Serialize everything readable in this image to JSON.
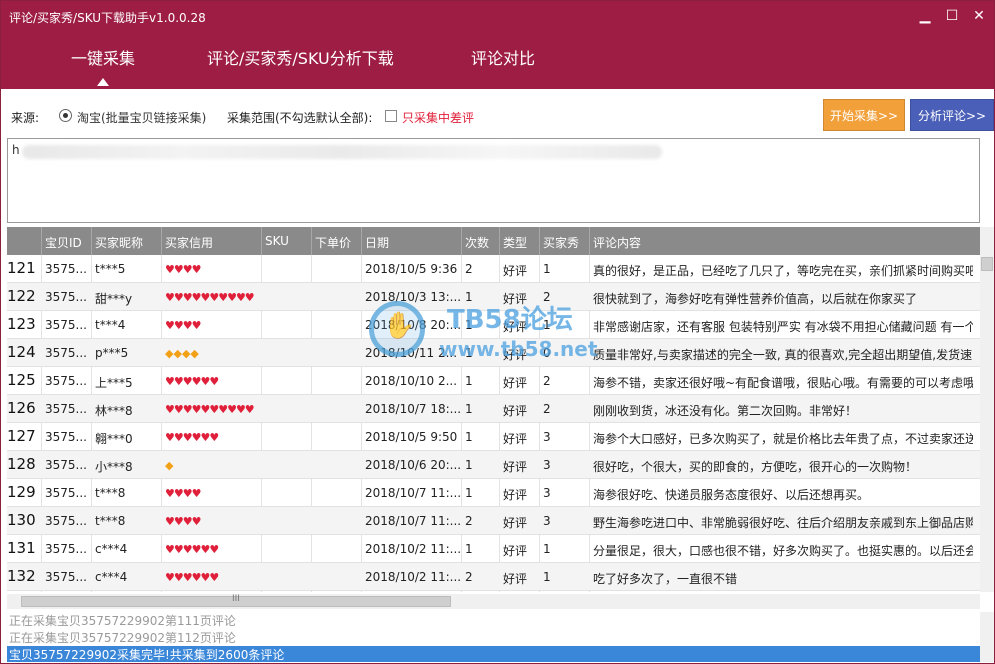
{
  "window": {
    "title": "评论/买家秀/SKU下载助手v1.0.0.28",
    "controls": {
      "minimize": "▁",
      "maximize": "☐",
      "close": "✕"
    }
  },
  "nav": {
    "tabs": [
      {
        "label": "一键采集",
        "active": true
      },
      {
        "label": "评论/买家秀/SKU分析下载",
        "active": false
      },
      {
        "label": "评论对比",
        "active": false
      }
    ]
  },
  "toolbar": {
    "source_label": "来源:",
    "source_option": "淘宝(批量宝贝链接采集)",
    "scope_label": "采集范围(不勾选默认全部):",
    "bad_only_label": "只采集中差评",
    "start_button": "开始采集>>",
    "analyze_button": "分析评论>>"
  },
  "url_input": {
    "value_prefix": "h"
  },
  "table": {
    "columns": [
      "宝贝ID",
      "买家昵称",
      "买家信用",
      "SKU",
      "下单价",
      "日期",
      "次数",
      "类型",
      "买家秀",
      "评论内容"
    ],
    "rows": [
      {
        "n": "121",
        "id": "3575...",
        "nick": "t***5",
        "credit": "hearts:2",
        "sku": "",
        "price": "",
        "date": "2018/10/5 9:36",
        "count": "2",
        "type": "好评",
        "show": "1",
        "content": "真的很好，是正品，已经吃了几只了，等吃完在买，亲们抓紧时间购买吧"
      },
      {
        "n": "122",
        "id": "3575...",
        "nick": "甜***y",
        "credit": "hearts:5",
        "sku": "",
        "price": "",
        "date": "2018/10/3 13:...",
        "count": "1",
        "type": "好评",
        "show": "2",
        "content": "很快就到了，海参好吃有弹性营养价值高，以后就在你家买了"
      },
      {
        "n": "123",
        "id": "3575...",
        "nick": "t***4",
        "credit": "hearts:2",
        "sku": "",
        "price": "",
        "date": "2018/10/8 20:...",
        "count": "1",
        "type": "好评",
        "show": "1",
        "content": "非常感谢店家，还有客服 包装特别严实 有冰袋不用担心储藏问题 有一个"
      },
      {
        "n": "124",
        "id": "3575...",
        "nick": "p***5",
        "credit": "gems:4",
        "sku": "",
        "price": "",
        "date": "2018/10/11 2...",
        "count": "1",
        "type": "好评",
        "show": "0",
        "content": "质量非常好,与卖家描述的完全一致, 真的很喜欢,完全超出期望值,发货速 度"
      },
      {
        "n": "125",
        "id": "3575...",
        "nick": "上***5",
        "credit": "hearts:3",
        "sku": "",
        "price": "",
        "date": "2018/10/10 2...",
        "count": "1",
        "type": "好评",
        "show": "2",
        "content": "海参不错，卖家还很好哦~有配食谱哦，很贴心哦。有需要的可以考虑哦。"
      },
      {
        "n": "126",
        "id": "3575...",
        "nick": "林***8",
        "credit": "hearts:5",
        "sku": "",
        "price": "",
        "date": "2018/10/7 18:...",
        "count": "1",
        "type": "好评",
        "show": "2",
        "content": "刚刚收到货，冰还没有化。第二次回购。非常好！"
      },
      {
        "n": "127",
        "id": "3575...",
        "nick": "翱***0",
        "credit": "hearts:3",
        "sku": "",
        "price": "",
        "date": "2018/10/5 9:50",
        "count": "1",
        "type": "好评",
        "show": "3",
        "content": "海参个大口感好，已多次购买了，就是价格比去年贵了点，不过卖家还送"
      },
      {
        "n": "128",
        "id": "3575...",
        "nick": "小***8",
        "credit": "gems:1",
        "sku": "",
        "price": "",
        "date": "2018/10/6 20:...",
        "count": "1",
        "type": "好评",
        "show": "3",
        "content": "很好吃，个很大，买的即食的，方便吃，很开心的一次购物！"
      },
      {
        "n": "129",
        "id": "3575...",
        "nick": "t***8",
        "credit": "hearts:2",
        "sku": "",
        "price": "",
        "date": "2018/10/7 11:...",
        "count": "1",
        "type": "好评",
        "show": "3",
        "content": "海参很好吃、快递员服务态度很好、以后还想再买。"
      },
      {
        "n": "130",
        "id": "3575...",
        "nick": "t***8",
        "credit": "hearts:2",
        "sku": "",
        "price": "",
        "date": "2018/10/7 11:...",
        "count": "2",
        "type": "好评",
        "show": "3",
        "content": "野生海参吃进口中、非常脆弱很好吃、往后介绍朋友亲戚到东上御品店购"
      },
      {
        "n": "131",
        "id": "3575...",
        "nick": "c***4",
        "credit": "hearts:3",
        "sku": "",
        "price": "",
        "date": "2018/10/2 11:...",
        "count": "1",
        "type": "好评",
        "show": "1",
        "content": "分量很足，很大，口感也很不错，好多次购买了。也挺实惠的。以后还会"
      },
      {
        "n": "132",
        "id": "3575...",
        "nick": "c***4",
        "credit": "hearts:3",
        "sku": "",
        "price": "",
        "date": "2018/10/2 11:...",
        "count": "2",
        "type": "好评",
        "show": "1",
        "content": "吃了好多次了，一直很不错"
      }
    ]
  },
  "watermark": {
    "title": "TB58论坛",
    "url": "www.tb58.net"
  },
  "log": {
    "lines": [
      "正在采集宝贝35757229902第111页评论",
      "正在采集宝贝35757229902第112页评论"
    ],
    "selected": "宝贝35757229902采集完毕!共采集到2600条评论"
  },
  "colors": {
    "brand": "#9d1d44",
    "start_button": "#f2a03a",
    "analyze_button": "#4a5fb8",
    "warning_text": "#e0203a"
  },
  "scroll": {
    "hscroll_marker": "III"
  }
}
